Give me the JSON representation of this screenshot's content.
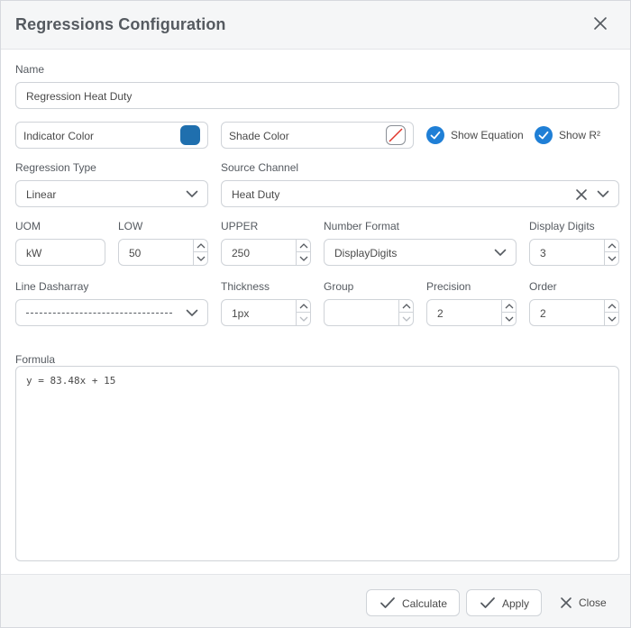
{
  "dialog": {
    "title": "Regressions Configuration"
  },
  "name": {
    "label": "Name",
    "value": "Regression Heat Duty"
  },
  "indicator_color": {
    "label": "Indicator Color",
    "color": "#1f6fae"
  },
  "shade_color": {
    "label": "Shade Color",
    "state": "none"
  },
  "show_equation": {
    "label": "Show Equation",
    "checked": true
  },
  "show_r2": {
    "label": "Show R²",
    "checked": true
  },
  "regression_type": {
    "label": "Regression Type",
    "value": "Linear"
  },
  "source_channel": {
    "label": "Source Channel",
    "value": "Heat Duty"
  },
  "uom": {
    "label": "UOM",
    "value": "kW"
  },
  "low": {
    "label": "LOW",
    "value": "50"
  },
  "upper": {
    "label": "UPPER",
    "value": "250"
  },
  "number_format": {
    "label": "Number Format",
    "value": "DisplayDigits"
  },
  "display_digits": {
    "label": "Display Digits",
    "value": "3"
  },
  "line_dasharray": {
    "label": "Line Dasharray",
    "value": "dashed"
  },
  "thickness": {
    "label": "Thickness",
    "value": "1px"
  },
  "group": {
    "label": "Group",
    "value": ""
  },
  "precision": {
    "label": "Precision",
    "value": "2"
  },
  "order": {
    "label": "Order",
    "value": "2"
  },
  "formula": {
    "label": "Formula",
    "value": "y = 83.48x + 15"
  },
  "footer": {
    "calculate_label": "Calculate",
    "apply_label": "Apply",
    "close_label": "Close"
  },
  "colors": {
    "accent": "#1f7fd6",
    "border": "#cfd3d8",
    "header_bg": "#f5f6f7"
  }
}
